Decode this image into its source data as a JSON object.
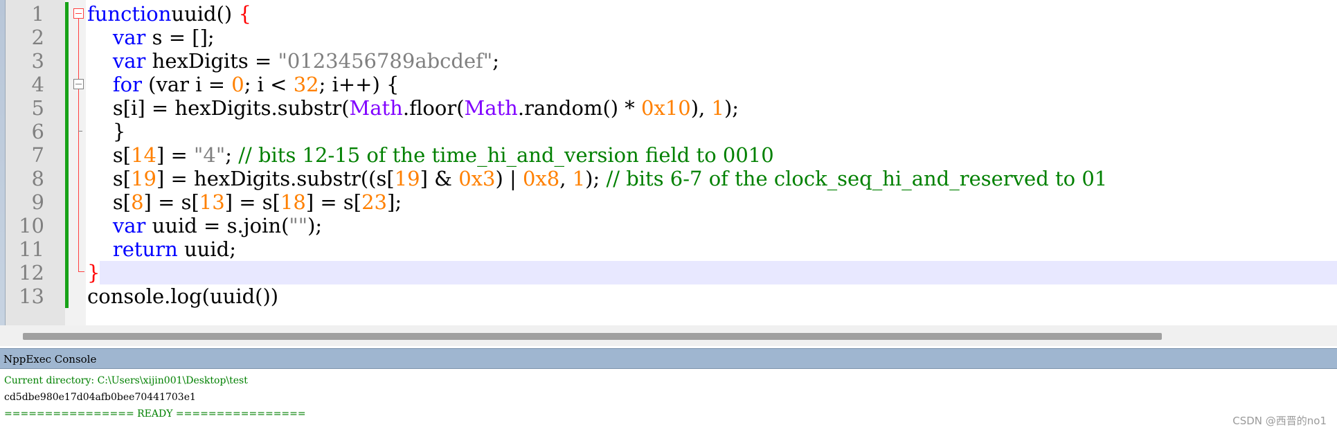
{
  "editor": {
    "line_numbers": [
      "1",
      "2",
      "3",
      "4",
      "5",
      "6",
      "7",
      "8",
      "9",
      "10",
      "11",
      "12",
      "13"
    ],
    "lines": [
      [
        [
          "kw",
          "function"
        ],
        [
          "",
          "uuid() "
        ],
        [
          "red",
          "{"
        ]
      ],
      [
        [
          "",
          "    "
        ],
        [
          "kw",
          "var"
        ],
        [
          "",
          " s = [];"
        ]
      ],
      [
        [
          "",
          "    "
        ],
        [
          "kw",
          "var"
        ],
        [
          "",
          " hexDigits = "
        ],
        [
          "str",
          "\"0123456789abcdef\""
        ],
        [
          "",
          ";"
        ]
      ],
      [
        [
          "",
          "    "
        ],
        [
          "kw",
          "for"
        ],
        [
          "",
          " (var i = "
        ],
        [
          "num",
          "0"
        ],
        [
          "",
          "; i < "
        ],
        [
          "num",
          "32"
        ],
        [
          "",
          "; i++) {"
        ]
      ],
      [
        [
          "",
          "    s[i] = hexDigits.substr("
        ],
        [
          "obj",
          "Math"
        ],
        [
          "",
          ".floor("
        ],
        [
          "obj",
          "Math"
        ],
        [
          "",
          ".random() * "
        ],
        [
          "num",
          "0x10"
        ],
        [
          "",
          "), "
        ],
        [
          "num",
          "1"
        ],
        [
          "",
          ");"
        ]
      ],
      [
        [
          "",
          "    }"
        ]
      ],
      [
        [
          "",
          "    s["
        ],
        [
          "num",
          "14"
        ],
        [
          "",
          "] = "
        ],
        [
          "str",
          "\"4\""
        ],
        [
          "",
          "; "
        ],
        [
          "com",
          "// bits 12-15 of the time_hi_and_version field to 0010"
        ]
      ],
      [
        [
          "",
          "    s["
        ],
        [
          "num",
          "19"
        ],
        [
          "",
          "] = hexDigits.substr((s["
        ],
        [
          "num",
          "19"
        ],
        [
          "",
          "] & "
        ],
        [
          "num",
          "0x3"
        ],
        [
          "",
          ") | "
        ],
        [
          "num",
          "0x8"
        ],
        [
          "",
          ", "
        ],
        [
          "num",
          "1"
        ],
        [
          "",
          "); "
        ],
        [
          "com",
          "// bits 6-7 of the clock_seq_hi_and_reserved to 01"
        ]
      ],
      [
        [
          "",
          "    s["
        ],
        [
          "num",
          "8"
        ],
        [
          "",
          "] = s["
        ],
        [
          "num",
          "13"
        ],
        [
          "",
          "] = s["
        ],
        [
          "num",
          "18"
        ],
        [
          "",
          "] = s["
        ],
        [
          "num",
          "23"
        ],
        [
          "",
          "];"
        ]
      ],
      [
        [
          "",
          "    "
        ],
        [
          "kw",
          "var"
        ],
        [
          "",
          " uuid = s.join("
        ],
        [
          "str",
          "\"\""
        ],
        [
          "",
          ");"
        ]
      ],
      [
        [
          "",
          "    "
        ],
        [
          "kw",
          "return"
        ],
        [
          "",
          " uuid;"
        ]
      ],
      [
        [
          "red",
          "}"
        ]
      ],
      [
        [
          "",
          "console.log(uuid())"
        ]
      ]
    ]
  },
  "console": {
    "title": "NppExec Console",
    "directory_line": "Current directory: C:\\Users\\xijin001\\Desktop\\test",
    "output_line": "cd5dbe980e17d04afb0bee70441703e1",
    "ready_line": "================ READY ================"
  },
  "watermark": "CSDN @西晋的no1",
  "colors": {
    "keyword": "#0000ff",
    "number": "#ff8000",
    "string": "#808080",
    "comment": "#008000",
    "object": "#8000ff",
    "console_green": "#008000",
    "console_header": "#9fb6d0",
    "current_line": "#e8e8ff",
    "change_bar": "#17a217"
  }
}
